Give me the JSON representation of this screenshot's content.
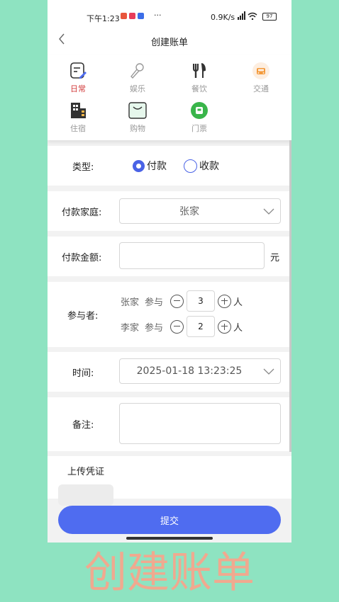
{
  "status": {
    "time": "下午1:23",
    "more": "···",
    "speed": "0.9K/s",
    "battery": "97"
  },
  "nav": {
    "title": "创建账单"
  },
  "categories": [
    {
      "label": "日常",
      "icon": "note-edit-icon"
    },
    {
      "label": "娱乐",
      "icon": "microphone-icon"
    },
    {
      "label": "餐饮",
      "icon": "fork-knife-icon"
    },
    {
      "label": "交通",
      "icon": "car-icon"
    },
    {
      "label": "住宿",
      "icon": "building-icon"
    },
    {
      "label": "购物",
      "icon": "shopping-bag-icon"
    },
    {
      "label": "门票",
      "icon": "ticket-icon"
    }
  ],
  "form": {
    "type_label": "类型:",
    "type_options": [
      "付款",
      "收款"
    ],
    "family_label": "付款家庭:",
    "family_value": "张家",
    "amount_label": "付款金额:",
    "amount_value": "",
    "amount_unit": "元",
    "participants_label": "参与者:",
    "participants": [
      {
        "family": "张家",
        "word": "参与",
        "count": "3",
        "unit": "人"
      },
      {
        "family": "李家",
        "word": "参与",
        "count": "2",
        "unit": "人"
      }
    ],
    "time_label": "时间:",
    "time_value": "2025-01-18 13:23:25",
    "note_label": "备注:",
    "upload_label": "上传凭证",
    "submit_label": "提交"
  },
  "caption": "创建账单",
  "colors": {
    "accent": "#4f6cf0",
    "active_category": "#d23c3c",
    "background": "#8ee3c1"
  }
}
